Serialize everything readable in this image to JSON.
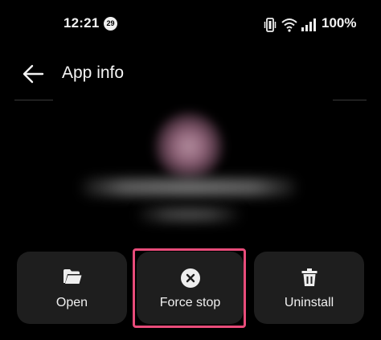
{
  "status_bar": {
    "time": "12:21",
    "notification_count": "29",
    "battery_percent": "100%",
    "icons": [
      "vibrate-icon",
      "wifi-icon",
      "signal-icon",
      "battery-icon"
    ]
  },
  "header": {
    "back_icon": "arrow-left-icon",
    "title": "App info"
  },
  "actions": [
    {
      "label": "Open",
      "icon": "folder-open-icon"
    },
    {
      "label": "Force stop",
      "icon": "close-circle-icon"
    },
    {
      "label": "Uninstall",
      "icon": "trash-icon"
    }
  ],
  "highlight_color": "#e84c7a",
  "colors": {
    "background": "#000000",
    "button_background": "#1e1e1e",
    "text": "#f0f0f0"
  }
}
